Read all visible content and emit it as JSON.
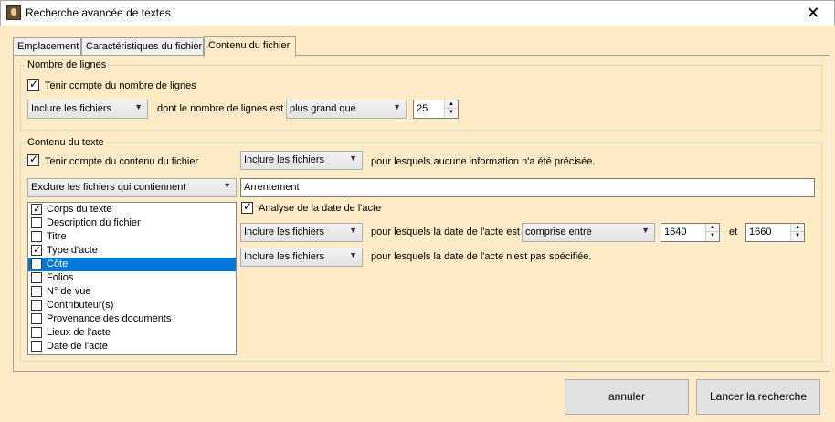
{
  "window": {
    "title": "Recherche avancée de textes",
    "close": "✕"
  },
  "tabs": [
    {
      "label": "Emplacement"
    },
    {
      "label": "Caractéristiques du fichier"
    },
    {
      "label": "Contenu du fichier"
    }
  ],
  "lines_group": {
    "legend": "Nombre de lignes",
    "check_label": "Tenir compte du nombre de lignes",
    "checked": true,
    "include_select": "Inclure les fichiers",
    "text_between": "dont le nombre de lignes est",
    "compare_select": "plus grand que",
    "count": "25"
  },
  "content_group": {
    "legend": "Contenu du texte",
    "check_label": "Tenir compte du contenu du fichier",
    "checked": true,
    "include_select": "Inclure les fichiers",
    "no_info_text": "pour lesquels aucune information n'a été précisée.",
    "exclude_select": "Exclure les fichiers qui contiennent",
    "search_value": "Arrentement",
    "fields": [
      {
        "label": "Corps du texte",
        "checked": true
      },
      {
        "label": "Description du fichier",
        "checked": false
      },
      {
        "label": "Titre",
        "checked": false
      },
      {
        "label": "Type d'acte",
        "checked": true
      },
      {
        "label": "Côte",
        "checked": false
      },
      {
        "label": "Folios",
        "checked": false
      },
      {
        "label": "N° de vue",
        "checked": false
      },
      {
        "label": "Contributeur(s)",
        "checked": false
      },
      {
        "label": "Provenance des documents",
        "checked": false
      },
      {
        "label": "Lieux de l'acte",
        "checked": false
      },
      {
        "label": "Date de l'acte",
        "checked": false
      }
    ],
    "selected_field": "Côte",
    "date_check_label": "Analyse de la date de l'acte",
    "date_checked": true,
    "date_include_select": "Inclure les fichiers",
    "date_text": "pour lesquels la date de l'acte est",
    "date_compare_select": "comprise entre",
    "date_from": "1640",
    "date_and": "et",
    "date_to": "1660",
    "nodate_include_select": "Inclure les fichiers",
    "nodate_text": "pour lesquels la date de l'acte n'est pas spécifiée."
  },
  "footer": {
    "cancel": "annuler",
    "search": "Lancer la recherche"
  },
  "icons": {
    "check": "✓",
    "dropdown": "▼",
    "spin_up": "▲",
    "spin_down": "▼"
  }
}
